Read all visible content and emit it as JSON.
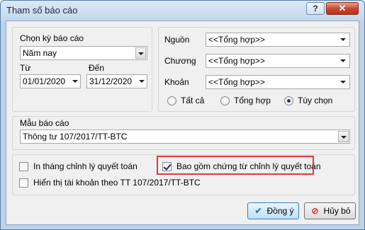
{
  "window": {
    "title": "Tham số báo cáo",
    "help_label": "?",
    "close_label": "✕"
  },
  "period": {
    "group_label": "Chọn kỳ báo cáo",
    "selected": "Năm nay",
    "from_label": "Từ",
    "from_value": "01/01/2020",
    "to_label": "Đến",
    "to_value": "31/12/2020"
  },
  "filters": {
    "source_label": "Nguồn",
    "source_value": "<<Tổng hợp>>",
    "chapter_label": "Chương",
    "chapter_value": "<<Tổng hợp>>",
    "item_label": "Khoản",
    "item_value": "<<Tổng hợp>>",
    "radio_all": "Tất cả",
    "radio_summary": "Tổng hợp",
    "radio_custom": "Tùy chọn",
    "radio_selected": "custom"
  },
  "template": {
    "label": "Mẫu báo cáo",
    "value": "Thông tư 107/2017/TT-BTC"
  },
  "options": {
    "print_adjust_month": {
      "label": "In tháng chỉnh lý quyết toán",
      "checked": false
    },
    "include_adjust_docs": {
      "label": "Bao gồm chứng từ chỉnh lý quyết toán",
      "checked": true
    },
    "show_account": {
      "label": "Hiển thị tài khoản theo TT 107/2017/TT-BTC",
      "checked": false
    }
  },
  "buttons": {
    "ok_label": "Đồng ý",
    "cancel_label": "Hủy bỏ"
  },
  "colors": {
    "highlight": "#e0393c",
    "ok_icon": "#2a7ab9",
    "cancel_icon": "#d33a2c"
  },
  "icons": {
    "ok": "check-icon",
    "cancel": "cancel-icon"
  }
}
